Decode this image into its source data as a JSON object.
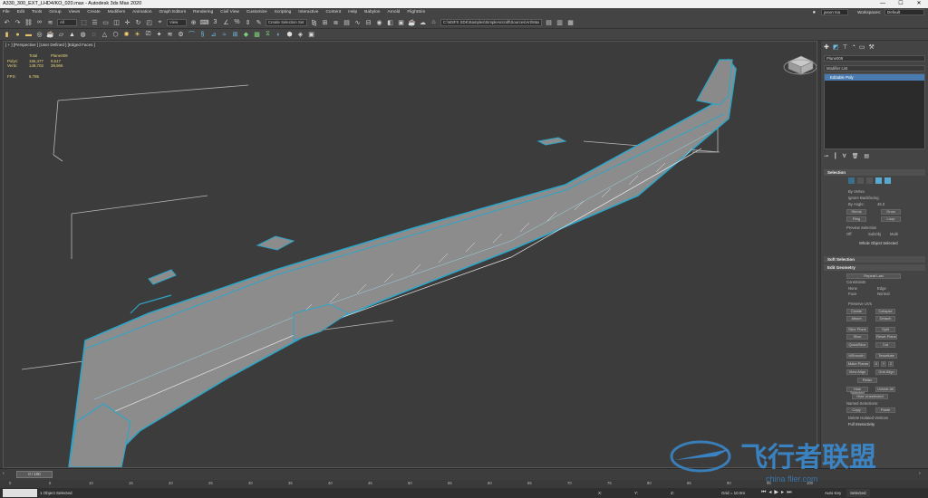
{
  "window": {
    "title": "A330_300_EXT_LHD4/KO_020.max - Autodesk 3ds Max 2020",
    "controls": [
      "—",
      "☐",
      "✕"
    ]
  },
  "menu": {
    "items": [
      "File",
      "Edit",
      "Tools",
      "Group",
      "Views",
      "Create",
      "Modifiers",
      "Animation",
      "Graph Editors",
      "Rendering",
      "Civil View",
      "Customize",
      "Scripting",
      "Interactive",
      "Content",
      "Help",
      "Babylon",
      "Arnold",
      "FlightSim"
    ],
    "user": "jason tsa",
    "workspaces_label": "Workspaces:",
    "workspace": "Default"
  },
  "toolbar1": {
    "filter": "All",
    "ref_coord": "View",
    "selection_set": "Create Selection Set",
    "project_path": "C:\\MSFS SDK\\Samples\\SimpleAircraft\\Sources\\Art\\Max"
  },
  "viewport": {
    "label": "[ + ] [Perspective ] [User Defined ] [Edged Faces ]",
    "stats": {
      "col_total": "Total",
      "col_object": "Plane009",
      "polys_label": "Polys:",
      "polys_total": "166,477",
      "polys_obj": "9,617",
      "verts_label": "Verts:",
      "verts_total": "149,703",
      "verts_obj": "39,966",
      "fps_label": "FPS:",
      "fps_value": "6.786"
    }
  },
  "command_panel": {
    "object_name": "Plane009",
    "modifier_list": "Modifier List",
    "stack_item": "Editable Poly",
    "selection": {
      "title": "Selection",
      "by_vertex": "By Vertex",
      "ignore_backfacing": "Ignore Backfacing",
      "by_angle": "By Angle:",
      "angle_value": "45.0",
      "shrink": "Shrink",
      "grow": "Grow",
      "ring": "Ring",
      "loop": "Loop",
      "preview_selection": "Preview Selection",
      "off": "Off",
      "subobj": "SubObj",
      "multi": "Multi",
      "whole_object": "Whole Object Selected"
    },
    "soft_selection": {
      "title": "Soft Selection"
    },
    "edit_geometry": {
      "title": "Edit Geometry",
      "repeat_last": "Repeat Last",
      "constraints": "Constraints",
      "none": "None",
      "edge": "Edge",
      "face": "Face",
      "normal": "Normal",
      "preserve_uvs": "Preserve UVs",
      "create": "Create",
      "collapse": "Collapse",
      "attach": "Attach",
      "detach": "Detach",
      "slice_plane": "Slice Plane",
      "split": "Split",
      "slice": "Slice",
      "reset_plane": "Reset Plane",
      "quickslice": "QuickSlice",
      "cut": "Cut",
      "msmooth": "MSmooth",
      "tessellate": "Tessellate",
      "make_planar": "Make Planar",
      "x": "X",
      "y": "Y",
      "z": "Z",
      "view_align": "View Align",
      "grid_align": "Grid Align",
      "relax": "Relax",
      "hide_selected": "Hide Selected",
      "unhide_all": "Unhide All",
      "hide_unselected": "Hide Unselected",
      "named_selections": "Named Selections:",
      "copy": "Copy",
      "paste": "Paste",
      "delete_isolated": "Delete Isolated Vertices",
      "full_interactivity": "Full Interactivity"
    }
  },
  "timeline": {
    "frame_counter": "0 / 100",
    "ticks": [
      "0",
      "5",
      "10",
      "15",
      "20",
      "25",
      "30",
      "35",
      "40",
      "45",
      "50",
      "55",
      "60",
      "65",
      "70",
      "75",
      "80",
      "85",
      "90",
      "95",
      "100"
    ]
  },
  "status": {
    "objects_selected": "1 Object Selected",
    "x_label": "X:",
    "y_label": "Y:",
    "z_label": "Z:",
    "grid": "Grid = 10.0m",
    "autokey": "Auto Key",
    "set_key": "Selected",
    "watermark_cn": "飞行者联盟",
    "watermark_url": "china flier.com"
  }
}
